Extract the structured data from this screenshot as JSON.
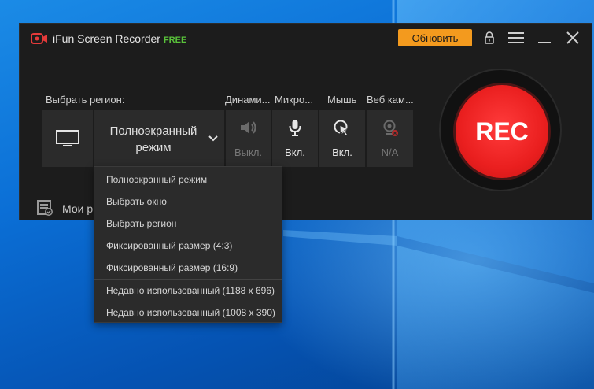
{
  "app": {
    "title": "iFun Screen Recorder",
    "edition": "FREE",
    "update_button": "Обновить",
    "my_recordings": "Мои р"
  },
  "labels": {
    "region": "Выбрать регион:",
    "speaker": "Динами...",
    "mic": "Микро...",
    "mouse": "Мышь",
    "webcam": "Веб кам..."
  },
  "mode": {
    "selected_line1": "Полноэкранный",
    "selected_line2": "режим"
  },
  "toggles": {
    "speaker": "Выкл.",
    "mic": "Вкл.",
    "mouse": "Вкл.",
    "webcam": "N/A"
  },
  "rec_label": "REC",
  "dropdown": [
    "Полноэкранный режим",
    "Выбрать окно",
    "Выбрать регион",
    "Фиксированный размер (4:3)",
    "Фиксированный размер (16:9)",
    "Недавно использованный (1188 x 696)",
    "Недавно использованный (1008 x 390)"
  ],
  "colors": {
    "accent_orange": "#f39a1e",
    "rec_red": "#ea1f1f",
    "free_green": "#59c23a",
    "window_bg": "#1c1c1c",
    "tile_bg": "#2b2b2b"
  },
  "icons": {
    "app_logo": "camera-record-icon",
    "lock": "lock-icon",
    "menu": "hamburger-icon",
    "minimize": "minimize-icon",
    "close": "close-icon",
    "monitor": "monitor-icon",
    "chevron": "chevron-down-icon",
    "speaker": "speaker-icon",
    "mic": "microphone-icon",
    "mouse": "mouse-cursor-icon",
    "webcam": "webcam-icon",
    "recordings": "recordings-list-icon"
  }
}
